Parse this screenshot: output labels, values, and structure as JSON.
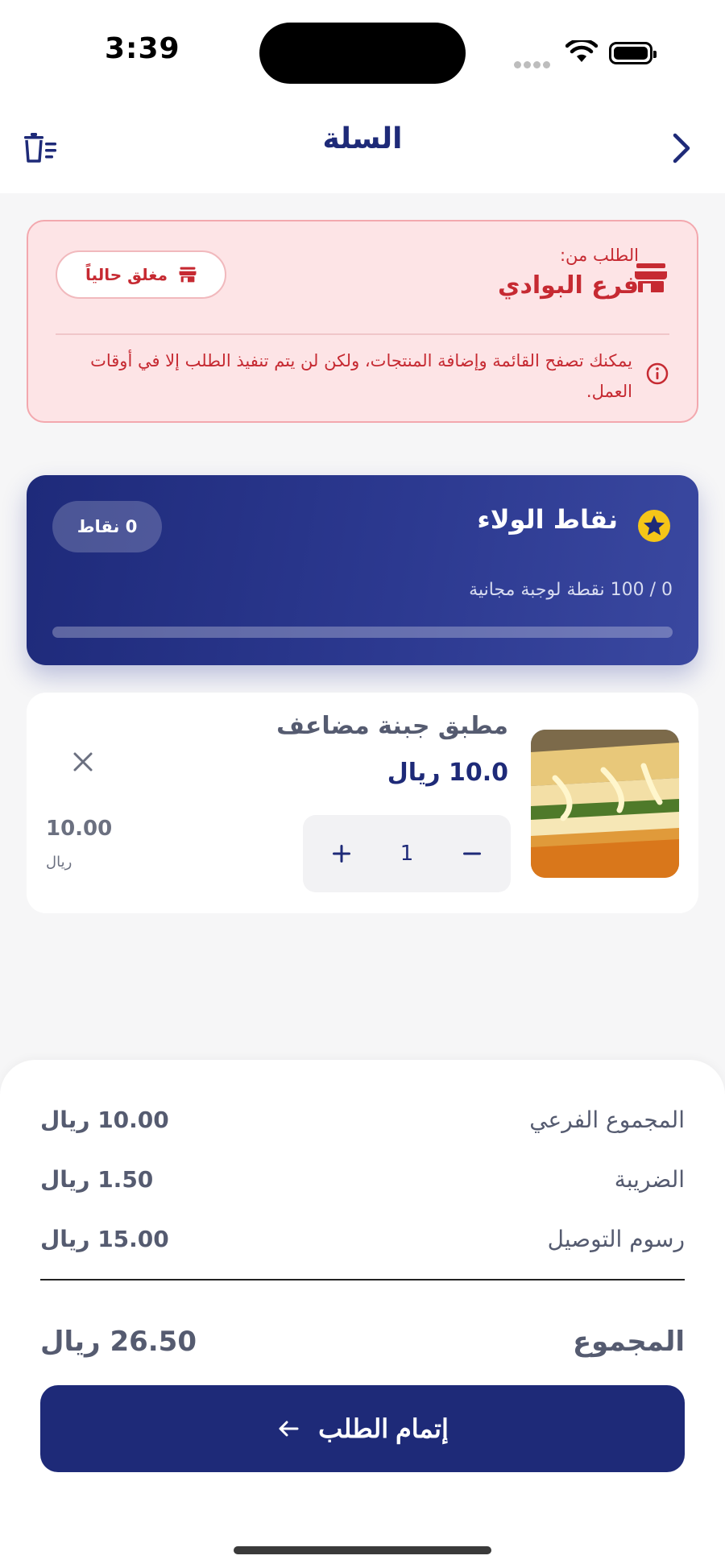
{
  "status_bar": {
    "time": "3:39"
  },
  "header": {
    "title": "السلة"
  },
  "branch": {
    "from_label": "الطلب من:",
    "name": "فرع البوادي",
    "status": "مغلق حالياً",
    "message": "يمكنك تصفح القائمة وإضافة المنتجات، ولكن لن يتم تنفيذ الطلب إلا في أوقات العمل.",
    "accent_color": "#c62a32"
  },
  "loyalty": {
    "title": "نقاط الولاء",
    "points_badge": "0 نقاط",
    "progress_text": "0 / 100 نقطة لوجبة مجانية",
    "progress_fraction": 0
  },
  "cart": {
    "items": [
      {
        "name": "مطبق جبنة مضاعف",
        "price": "10.0 ريال",
        "quantity": "1",
        "line_total": "10.00",
        "line_currency": "ريال"
      }
    ]
  },
  "summary": {
    "subtotal_label": "المجموع الفرعي",
    "subtotal_value": "10.00 ريال",
    "tax_label": "الضريبة",
    "tax_value": "1.50 ريال",
    "delivery_label": "رسوم التوصيل",
    "delivery_value": "15.00 ريال",
    "total_label": "المجموع",
    "total_value": "26.50 ريال"
  },
  "checkout": {
    "label": "إتمام الطلب"
  },
  "colors": {
    "primary": "#1e2a78",
    "danger": "#c62a32",
    "star": "#f5c518"
  }
}
